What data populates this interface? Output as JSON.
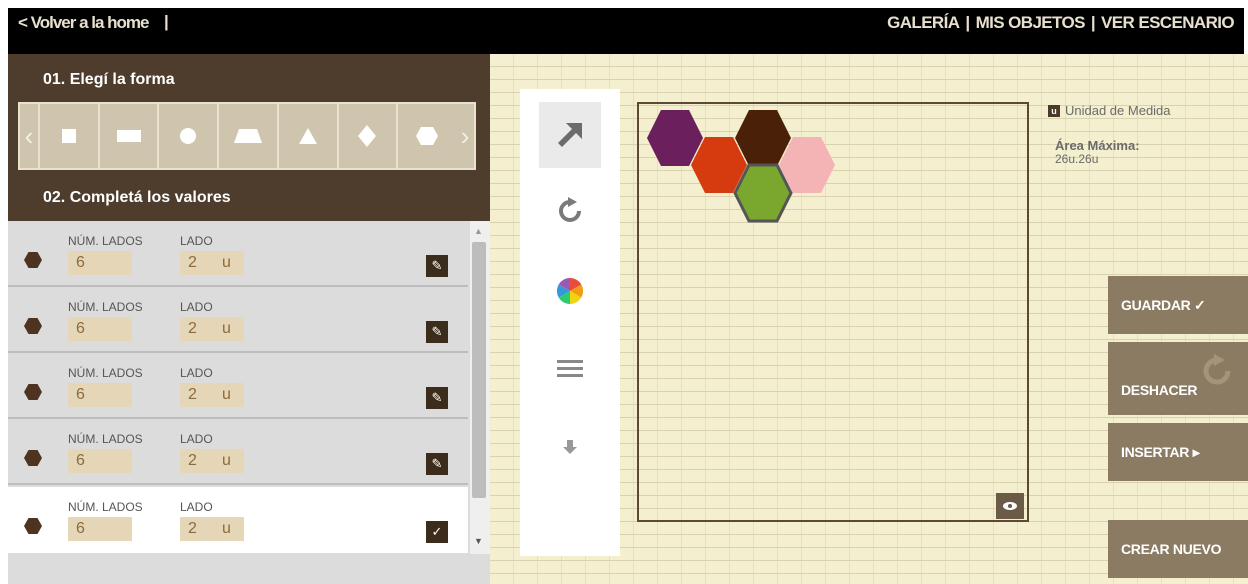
{
  "header": {
    "back_link": "< Volver a la home",
    "back_separator": "|",
    "nav": [
      "GALERÍA",
      "MIS OBJETOS",
      "VER ESCENARIO"
    ],
    "nav_separator": "|"
  },
  "left_panel": {
    "step1_title": "01. Elegí la forma",
    "step2_title": "02. Completá los valores",
    "shapes": [
      "square",
      "rectangle",
      "circle",
      "trapezoid",
      "triangle",
      "diamond",
      "hexagon"
    ],
    "rows": [
      {
        "sides_label": "NÚM. LADOS",
        "sides_value": "6",
        "side_label": "LADO",
        "side_value": "2",
        "unit": "u",
        "action": "edit"
      },
      {
        "sides_label": "NÚM. LADOS",
        "sides_value": "6",
        "side_label": "LADO",
        "side_value": "2",
        "unit": "u",
        "action": "edit"
      },
      {
        "sides_label": "NÚM. LADOS",
        "sides_value": "6",
        "side_label": "LADO",
        "side_value": "2",
        "unit": "u",
        "action": "edit"
      },
      {
        "sides_label": "NÚM. LADOS",
        "sides_value": "6",
        "side_label": "LADO",
        "side_value": "2",
        "unit": "u",
        "action": "edit"
      },
      {
        "sides_label": "NÚM. LADOS",
        "sides_value": "6",
        "side_label": "LADO",
        "side_value": "2",
        "unit": "u",
        "action": "confirm"
      }
    ]
  },
  "toolbar": {
    "tools": [
      "move-arrow-icon",
      "rotate-icon",
      "color-wheel-icon",
      "menu-icon",
      "send-back-icon"
    ],
    "selected": "move-arrow-icon"
  },
  "canvas": {
    "unit_icon_letter": "u",
    "unit_legend": "Unidad de Medida",
    "max_area_label": "Área Máxima:",
    "max_area_value": "26u.26u",
    "hexagons": [
      {
        "color": "#6b1f5c"
      },
      {
        "color": "#4a2008"
      },
      {
        "color": "#d63a0f"
      },
      {
        "color": "#f4b3b5"
      },
      {
        "color": "#7aa82e",
        "selected": true
      }
    ]
  },
  "actions": {
    "save": "GUARDAR  ✓",
    "undo": "DESHACER",
    "insert": "INSERTAR  ▸",
    "new": "CREAR NUEVO"
  },
  "colors": {
    "brown_dark": "#4e3d2c",
    "tan_field": "#e5d6b8",
    "button_brown": "#8c7b63",
    "canvas_bg": "#f4efcf"
  }
}
